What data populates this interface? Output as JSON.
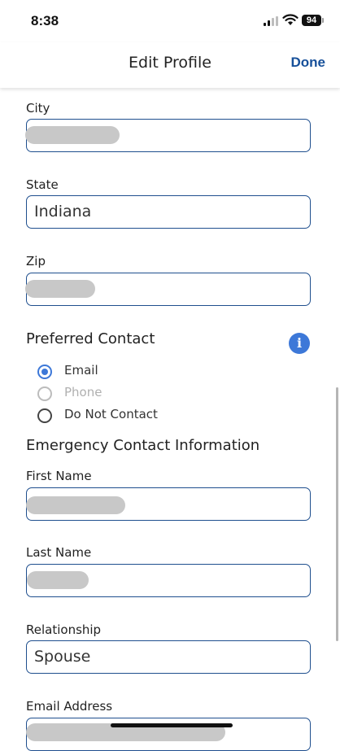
{
  "status_bar": {
    "time": "8:38",
    "battery": "94"
  },
  "nav": {
    "title": "Edit Profile",
    "done_label": "Done"
  },
  "fields": {
    "city": {
      "label": "City",
      "value": ""
    },
    "state": {
      "label": "State",
      "value": "Indiana"
    },
    "zip": {
      "label": "Zip",
      "value": ""
    }
  },
  "preferred_contact": {
    "title": "Preferred Contact",
    "options": [
      {
        "label": "Email",
        "state": "selected"
      },
      {
        "label": "Phone",
        "state": "disabled"
      },
      {
        "label": "Do Not Contact",
        "state": "unselected"
      }
    ]
  },
  "emergency": {
    "title": "Emergency Contact Information",
    "first_name": {
      "label": "First Name",
      "value": ""
    },
    "last_name": {
      "label": "Last Name",
      "value": ""
    },
    "relationship": {
      "label": "Relationship",
      "value": "Spouse"
    },
    "email": {
      "label": "Email Address",
      "value": ""
    }
  },
  "colors": {
    "accent": "#3d78d8",
    "border": "#1f4f8e",
    "done": "#17509a"
  },
  "icons": [
    "signal-icon",
    "wifi-icon",
    "battery-icon",
    "info-icon"
  ]
}
